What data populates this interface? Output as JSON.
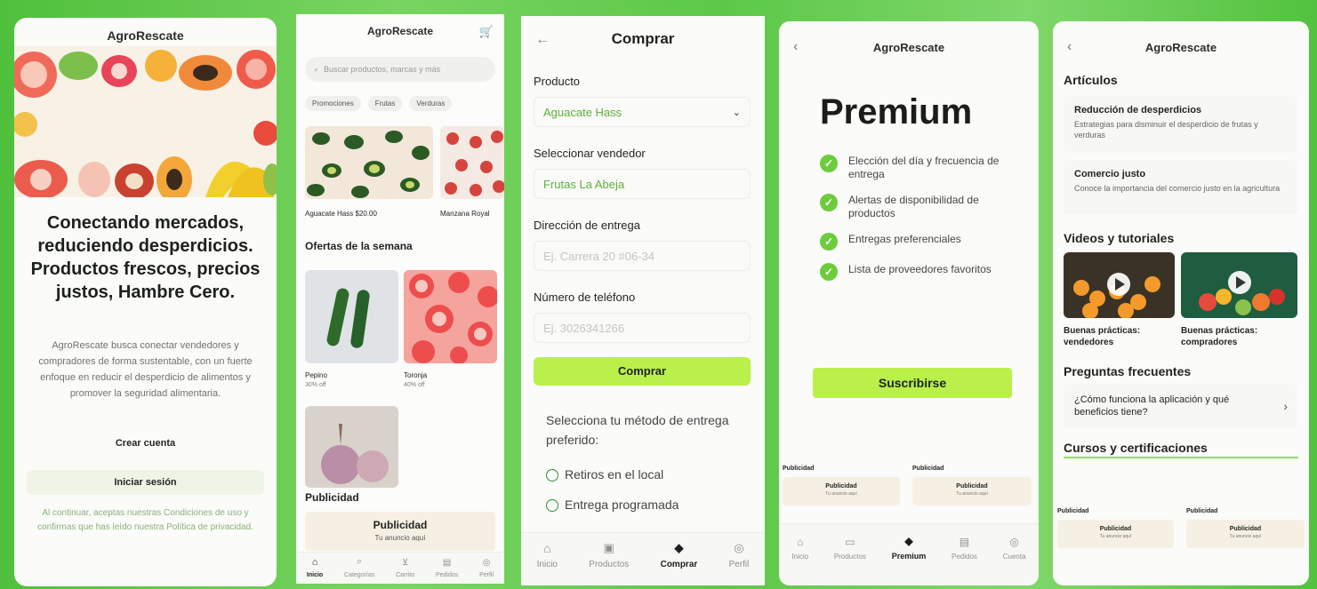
{
  "s1": {
    "title": "AgroRescate",
    "headline": "Conectando mercados, reduciendo desperdicios. Productos frescos, precios justos, Hambre Cero.",
    "desc": "AgroRescate busca conectar vendedores y compradores de forma sustentable, con un fuerte enfoque en reducir el desperdicio de alimentos y promover la seguridad alimentaria.",
    "create": "Crear cuenta",
    "login": "Iniciar sesión",
    "legal": "Al continuar, aceptas nuestras Condiciones de uso y confirmas que has leído nuestra Política de privacidad."
  },
  "s2": {
    "title": "AgroRescate",
    "search_placeholder": "Buscar productos, marcas y más",
    "chips": [
      "Promociones",
      "Frutas",
      "Verduras"
    ],
    "product1": "Aguacate Hass $20.00",
    "product2": "Manzana Royal",
    "offers_title": "Ofertas de la semana",
    "offer1_name": "Pepino",
    "offer1_disc": "30% off",
    "offer2_name": "Toronja",
    "offer2_disc": "40% off",
    "ad_section": "Publicidad",
    "ad_title": "Publicidad",
    "ad_sub": "Tu anuncio aquí",
    "nav": [
      "Inicio",
      "Categorías",
      "Carrito",
      "Pedidos",
      "Perfil"
    ]
  },
  "s3": {
    "title": "Comprar",
    "product_label": "Producto",
    "product_value": "Aguacate Hass",
    "seller_label": "Seleccionar vendedor",
    "seller_value": "Frutas La Abeja",
    "address_label": "Dirección de entrega",
    "address_placeholder": "Ej. Carrera 20 #06-34",
    "phone_label": "Número de teléfono",
    "phone_placeholder": "Ej. 3026341266",
    "buy": "Comprar",
    "delivery_q": "Selecciona tu método de entrega preferido:",
    "opt1": "Retiros en el local",
    "opt2": "Entrega programada",
    "nav": [
      "Inicio",
      "Productos",
      "Comprar",
      "Perfil"
    ]
  },
  "s4": {
    "title": "AgroRescate",
    "heading": "Premium",
    "features": [
      "Elección del día y frecuencia de entrega",
      "Alertas de disponibilidad de productos",
      "Entregas preferenciales",
      "Lista de proveedores favoritos"
    ],
    "subscribe": "Suscribirse",
    "ad_label": "Publicidad",
    "ad_title": "Publicidad",
    "ad_sub": "Tu anuncio aquí",
    "nav": [
      "Inicio",
      "Productos",
      "Premium",
      "Pedidos",
      "Cuenta"
    ]
  },
  "s5": {
    "title": "AgroRescate",
    "articles": "Artículos",
    "a1_title": "Reducción de desperdicios",
    "a1_desc": "Estrategias para disminuir el desperdicio de frutas y verduras",
    "a2_title": "Comercio justo",
    "a2_desc": "Conoce la importancia del comercio justo en la agricultura",
    "videos": "Videos y tutoriales",
    "v1": "Buenas prácticas: vendedores",
    "v2": "Buenas prácticas: compradores",
    "faq": "Preguntas frecuentes",
    "faq1": "¿Cómo funciona la aplicación y qué beneficios tiene?",
    "courses": "Cursos y certificaciones",
    "ad_label": "Publicidad",
    "ad_title": "Publicidad",
    "ad_sub": "Tu anuncio aquí"
  },
  "colors": {
    "accent": "#b9f04a",
    "green": "#6dcc3b",
    "bg": "#58c542"
  }
}
